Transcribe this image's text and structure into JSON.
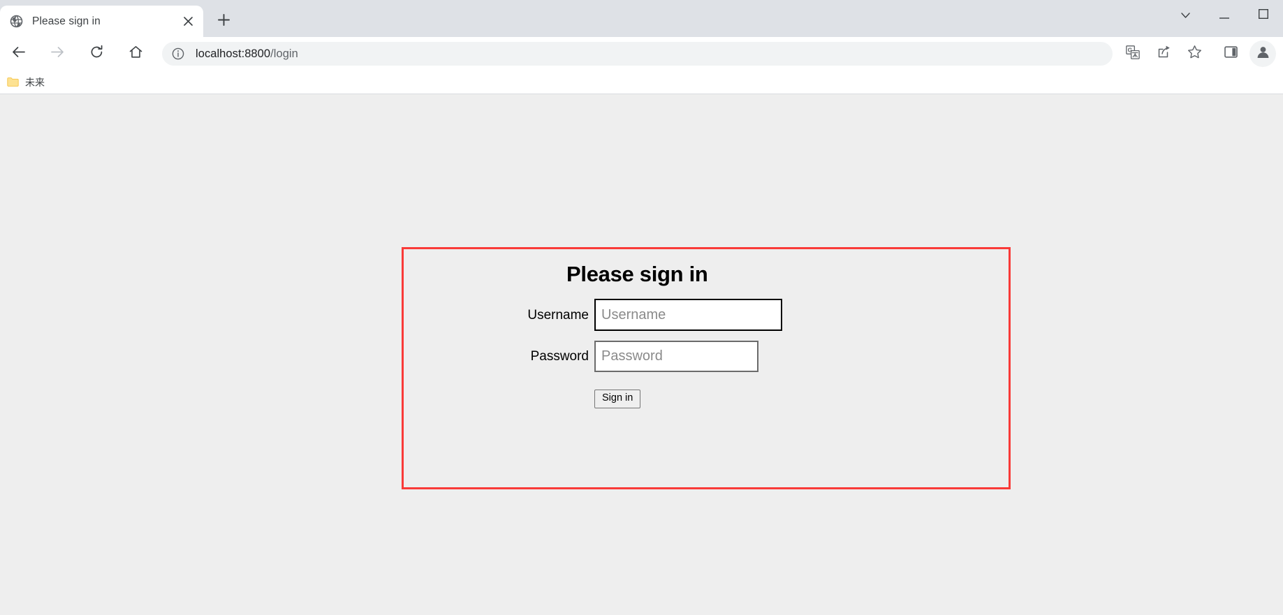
{
  "browser": {
    "tab": {
      "title": "Please sign in",
      "favicon_icon": "globe-icon",
      "close_icon": "close-icon"
    },
    "new_tab_icon": "plus-icon",
    "window_controls": [
      {
        "name": "tab-search",
        "icon": "chevron-down-icon"
      },
      {
        "name": "minimize",
        "icon": "minimize-icon"
      },
      {
        "name": "maximize",
        "icon": "maximize-icon"
      }
    ],
    "nav_buttons": [
      {
        "name": "back",
        "icon": "arrow-left-icon"
      },
      {
        "name": "forward",
        "icon": "arrow-right-icon"
      },
      {
        "name": "reload",
        "icon": "reload-icon"
      },
      {
        "name": "home",
        "icon": "home-icon"
      }
    ],
    "omnibox": {
      "site_info_icon": "info-circle-icon",
      "url_host": "localhost:8800",
      "url_path": "/login",
      "url_full": "localhost:8800/login"
    },
    "toolbar_actions": [
      {
        "name": "translate",
        "icon": "translate-icon"
      },
      {
        "name": "share",
        "icon": "share-icon"
      },
      {
        "name": "bookmark",
        "icon": "star-icon"
      },
      {
        "name": "side-panel",
        "icon": "side-panel-icon"
      },
      {
        "name": "profile",
        "icon": "avatar-icon"
      }
    ],
    "bookmarks": [
      {
        "label": "未来",
        "icon": "folder-icon"
      }
    ]
  },
  "page": {
    "background_color": "#eeeeee",
    "highlight_box_color": "#f93a38",
    "form": {
      "title": "Please sign in",
      "username": {
        "label": "Username",
        "placeholder": "Username",
        "value": "",
        "focused": true
      },
      "password": {
        "label": "Password",
        "placeholder": "Password",
        "value": "",
        "focused": false
      },
      "submit_label": "Sign in"
    }
  }
}
